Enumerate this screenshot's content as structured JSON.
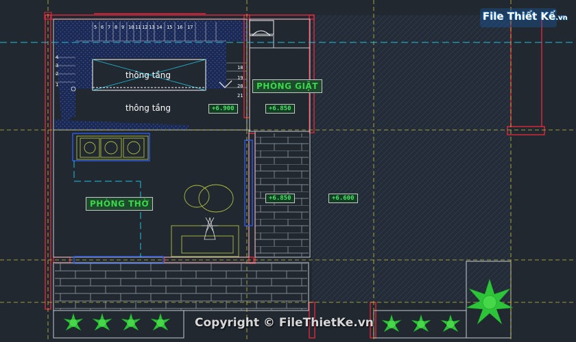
{
  "labels": {
    "thong_tang_1": "thông tầng",
    "thong_tang_2": "thông tầng",
    "phong_giat": "PHÒNG GIẶT",
    "phong_tho": "PHÒNG THỜ"
  },
  "levels": {
    "lv1": "+6.900",
    "lv2": "+6.850",
    "lv3": "+6.850",
    "lv4": "+6.600"
  },
  "stair_steps_top": [
    "5",
    "6",
    "7",
    "8",
    "9",
    "10",
    "11",
    "12",
    "13",
    "14",
    "15",
    "16",
    "17"
  ],
  "stair_steps_left": [
    "4",
    "3",
    "2",
    "1"
  ],
  "stair_steps_right": [
    "19",
    "20",
    "21"
  ],
  "stair_step_18": "18",
  "watermark": {
    "logo_main": "File Thiết Kế",
    "logo_tld": ".vn",
    "copyright": "Copyright © FileThietKe.vn"
  },
  "colors": {
    "background": "#212830",
    "wall_red": "#e0283c",
    "guide_cyan": "#1fc2e0",
    "guide_yellow": "#c8c23a",
    "label_green": "#3bd64a",
    "plant_green": "#2ec43a"
  }
}
